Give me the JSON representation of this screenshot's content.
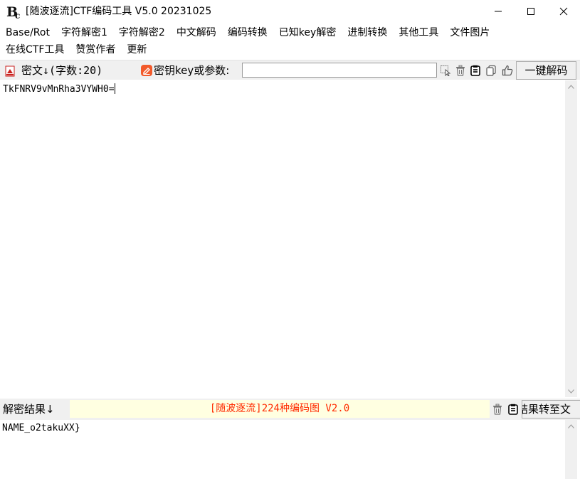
{
  "window": {
    "title": "[随波逐流]CTF编码工具 V5.0 20231025",
    "logo_icon": "bc-logo-icon",
    "controls": [
      "minimize-icon",
      "maximize-icon",
      "close-icon"
    ]
  },
  "menu": {
    "row1": [
      "Base/Rot",
      "字符解密1",
      "字符解密2",
      "中文解码",
      "编码转换",
      "已知key解密",
      "进制转换",
      "其他工具",
      "文件图片"
    ],
    "row2": [
      "在线CTF工具",
      "赞赏作者",
      "更新"
    ]
  },
  "cipher_bar": {
    "label": "密文",
    "arrow": "↓",
    "count": "(字数:20)",
    "key_label": "密钥key或参数:",
    "key_value": "",
    "tools": [
      "select-icon",
      "trash-icon",
      "paste-icon",
      "copy-icon",
      "thumbs-up-icon"
    ],
    "decode_button": "一键解码"
  },
  "cipher_text": "TkFNRV9vMnRha3VYWH0=",
  "result_bar": {
    "label": "解密结果↓",
    "banner": "[随波逐流]224种编码图 V2.0",
    "tools": [
      "trash-icon",
      "paste-icon"
    ],
    "copy_button": "结果转至文"
  },
  "result_text": "NAME_o2takuXX}",
  "colors": {
    "toolbar_bg": "#f0f0f0",
    "banner_bg": "#ffffe1",
    "banner_text": "#ff2a00",
    "key_icon": "#f25a2b"
  }
}
